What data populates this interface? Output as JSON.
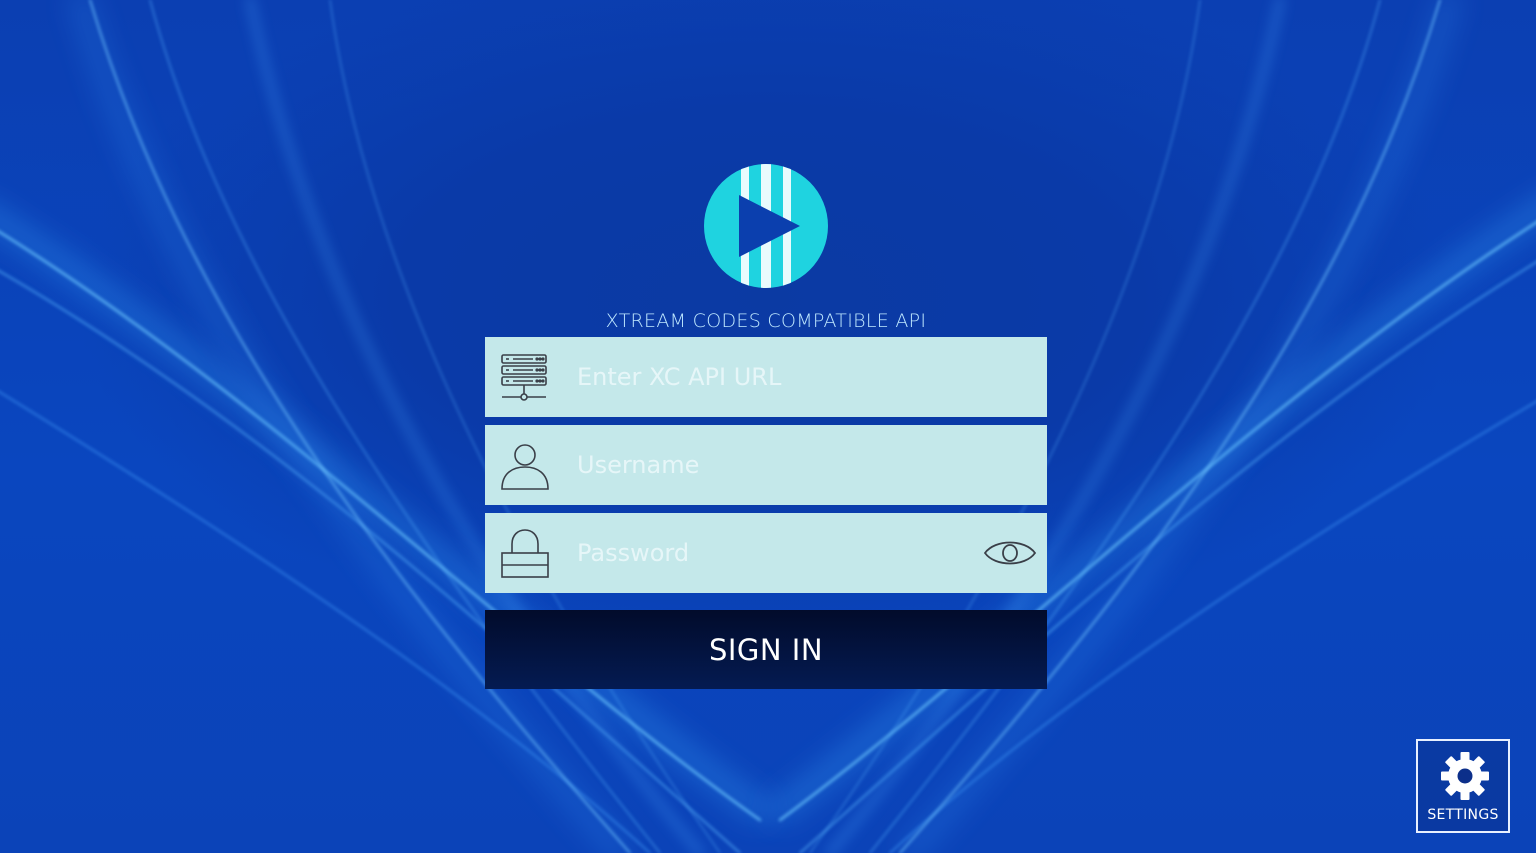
{
  "app": {
    "subtitle": "XTREAM CODES COMPATIBLE API"
  },
  "form": {
    "url_field": {
      "placeholder": "Enter XC API URL",
      "value": "",
      "icon": "server-network-icon"
    },
    "username_field": {
      "placeholder": "Username",
      "value": "",
      "icon": "user-icon"
    },
    "password_field": {
      "placeholder": "Password",
      "value": "",
      "icon": "lock-icon",
      "toggle_icon": "eye-icon"
    },
    "sign_in_label": "SIGN IN"
  },
  "settings": {
    "label": "SETTINGS",
    "icon": "gear-icon"
  },
  "colors": {
    "background": "#0a3fae",
    "field_bg": "#c4e8ea",
    "button_bg": "#020b2b",
    "logo_accent": "#1fd3e0"
  }
}
